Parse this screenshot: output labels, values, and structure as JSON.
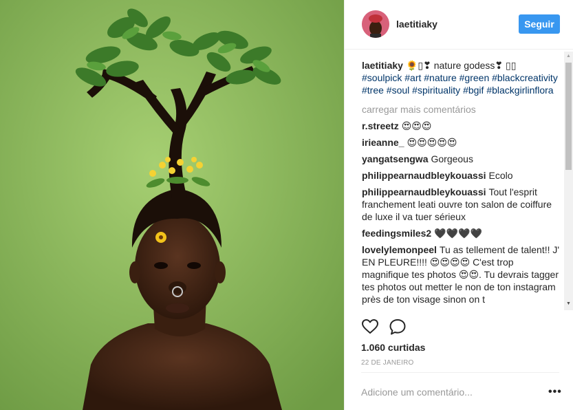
{
  "post": {
    "username": "laetitiaky",
    "follow_label": "Seguir",
    "caption_user": "laetitiaky",
    "caption_text": "🌻▯❣ nature godess❣ ▯▯",
    "hashtags": "#soulpick #art #nature #green #blackcreativity #tree #soul #spirituality #bgif #blackgirlinflora",
    "load_more": "carregar mais comentários",
    "likes": "1.060 curtidas",
    "date": "22 DE JANEIRO",
    "add_comment_placeholder": "Adicione um comentário...",
    "more_options": "•••"
  },
  "comments": [
    {
      "user": "r.streetz",
      "text": "😍😍😍"
    },
    {
      "user": "irieanne_",
      "text": "😍😍😍😍😍"
    },
    {
      "user": "yangatsengwa",
      "text": "Gorgeous"
    },
    {
      "user": "philippearnaudbleykouassi",
      "text": "Ecolo"
    },
    {
      "user": "philippearnaudbleykouassi",
      "text": "Tout l'esprit franchement leati ouvre ton salon de coiffure de luxe il va tuer sérieux"
    },
    {
      "user": "feedingsmiles2",
      "text": "🖤🖤🖤🖤"
    },
    {
      "user": "lovelylemonpeel",
      "text": "Tu as tellement de talent!! J' EN PLEURE!!!! 😍😍😍😍 C'est trop magnifique tes photos 😍😍. Tu devrais tagger tes photos out metter le non de ton instagram près de ton visage sinon on t"
    }
  ],
  "icons": {
    "like": "heart-icon",
    "comment": "speech-bubble-icon",
    "more": "ellipsis-icon"
  },
  "colors": {
    "follow_button": "#3897f0",
    "hashtag": "#003569",
    "muted": "#999999",
    "photo_background": "#8db85c"
  }
}
